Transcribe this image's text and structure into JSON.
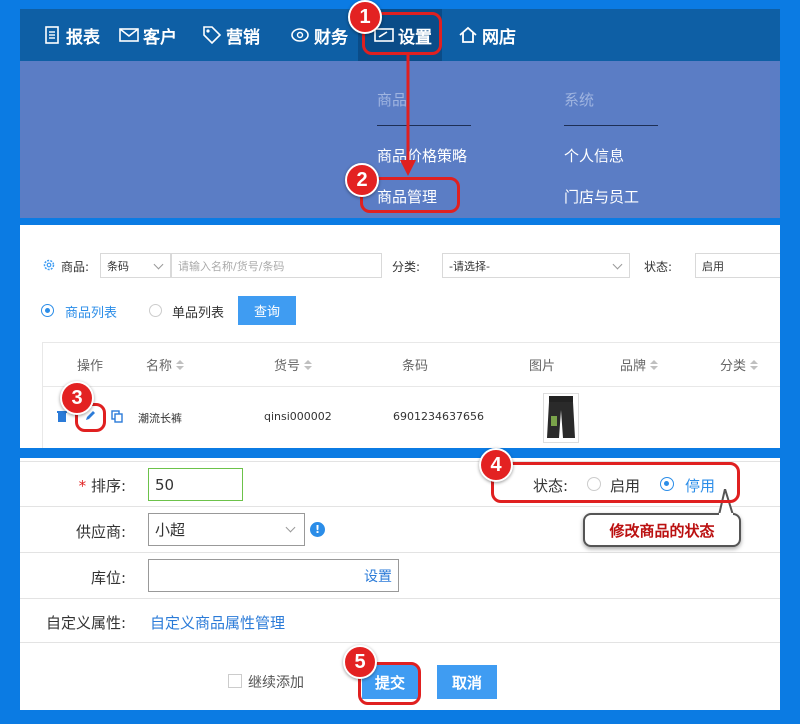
{
  "nav": {
    "items": [
      {
        "label": "报表",
        "icon": "report-icon"
      },
      {
        "label": "客户",
        "icon": "mail-icon"
      },
      {
        "label": "营销",
        "icon": "tag-icon"
      },
      {
        "label": "财务",
        "icon": "coin-icon"
      },
      {
        "label": "设置",
        "icon": "settings-card-icon",
        "active": true
      },
      {
        "label": "网店",
        "icon": "home-icon"
      }
    ],
    "menu": {
      "groups": [
        {
          "title": "商品",
          "links": [
            "商品价格策略",
            "商品管理"
          ]
        },
        {
          "title": "系统",
          "links": [
            "个人信息",
            "门店与员工"
          ]
        }
      ]
    }
  },
  "list": {
    "filters": {
      "product_label": "商品:",
      "product_type_value": "条码",
      "product_search_placeholder": "请输入名称/货号/条码",
      "category_label": "分类:",
      "category_value": "-请选择-",
      "status_label": "状态:",
      "status_value": "启用"
    },
    "view_modes": [
      "商品列表",
      "单品列表"
    ],
    "query_button": "查询",
    "columns": [
      "操作",
      "名称",
      "货号",
      "条码",
      "图片",
      "品牌",
      "分类"
    ],
    "rows": [
      {
        "name": "潮流长裤",
        "sku": "qinsi000002",
        "barcode": "6901234637656"
      }
    ]
  },
  "form": {
    "sort_label": "排序:",
    "sort_value": "50",
    "status_label": "状态:",
    "status_options": [
      "启用",
      "停用"
    ],
    "status_selected": "停用",
    "supplier_label": "供应商:",
    "supplier_value": "小超",
    "location_label": "库位:",
    "location_link": "设置",
    "custom_attr_label": "自定义属性:",
    "custom_attr_link": "自定义商品属性管理",
    "continue_add_label": "继续添加",
    "submit_button": "提交",
    "cancel_button": "取消"
  },
  "annotations": {
    "badges": [
      "1",
      "2",
      "3",
      "4",
      "5"
    ],
    "callout": "修改商品的状态"
  },
  "colors": {
    "nav_bar": "#0e5fa5",
    "menu_bg": "#5b7dc5",
    "accent": "#3f9cf2",
    "annotation": "#e02020",
    "background": "#0b7be3"
  }
}
